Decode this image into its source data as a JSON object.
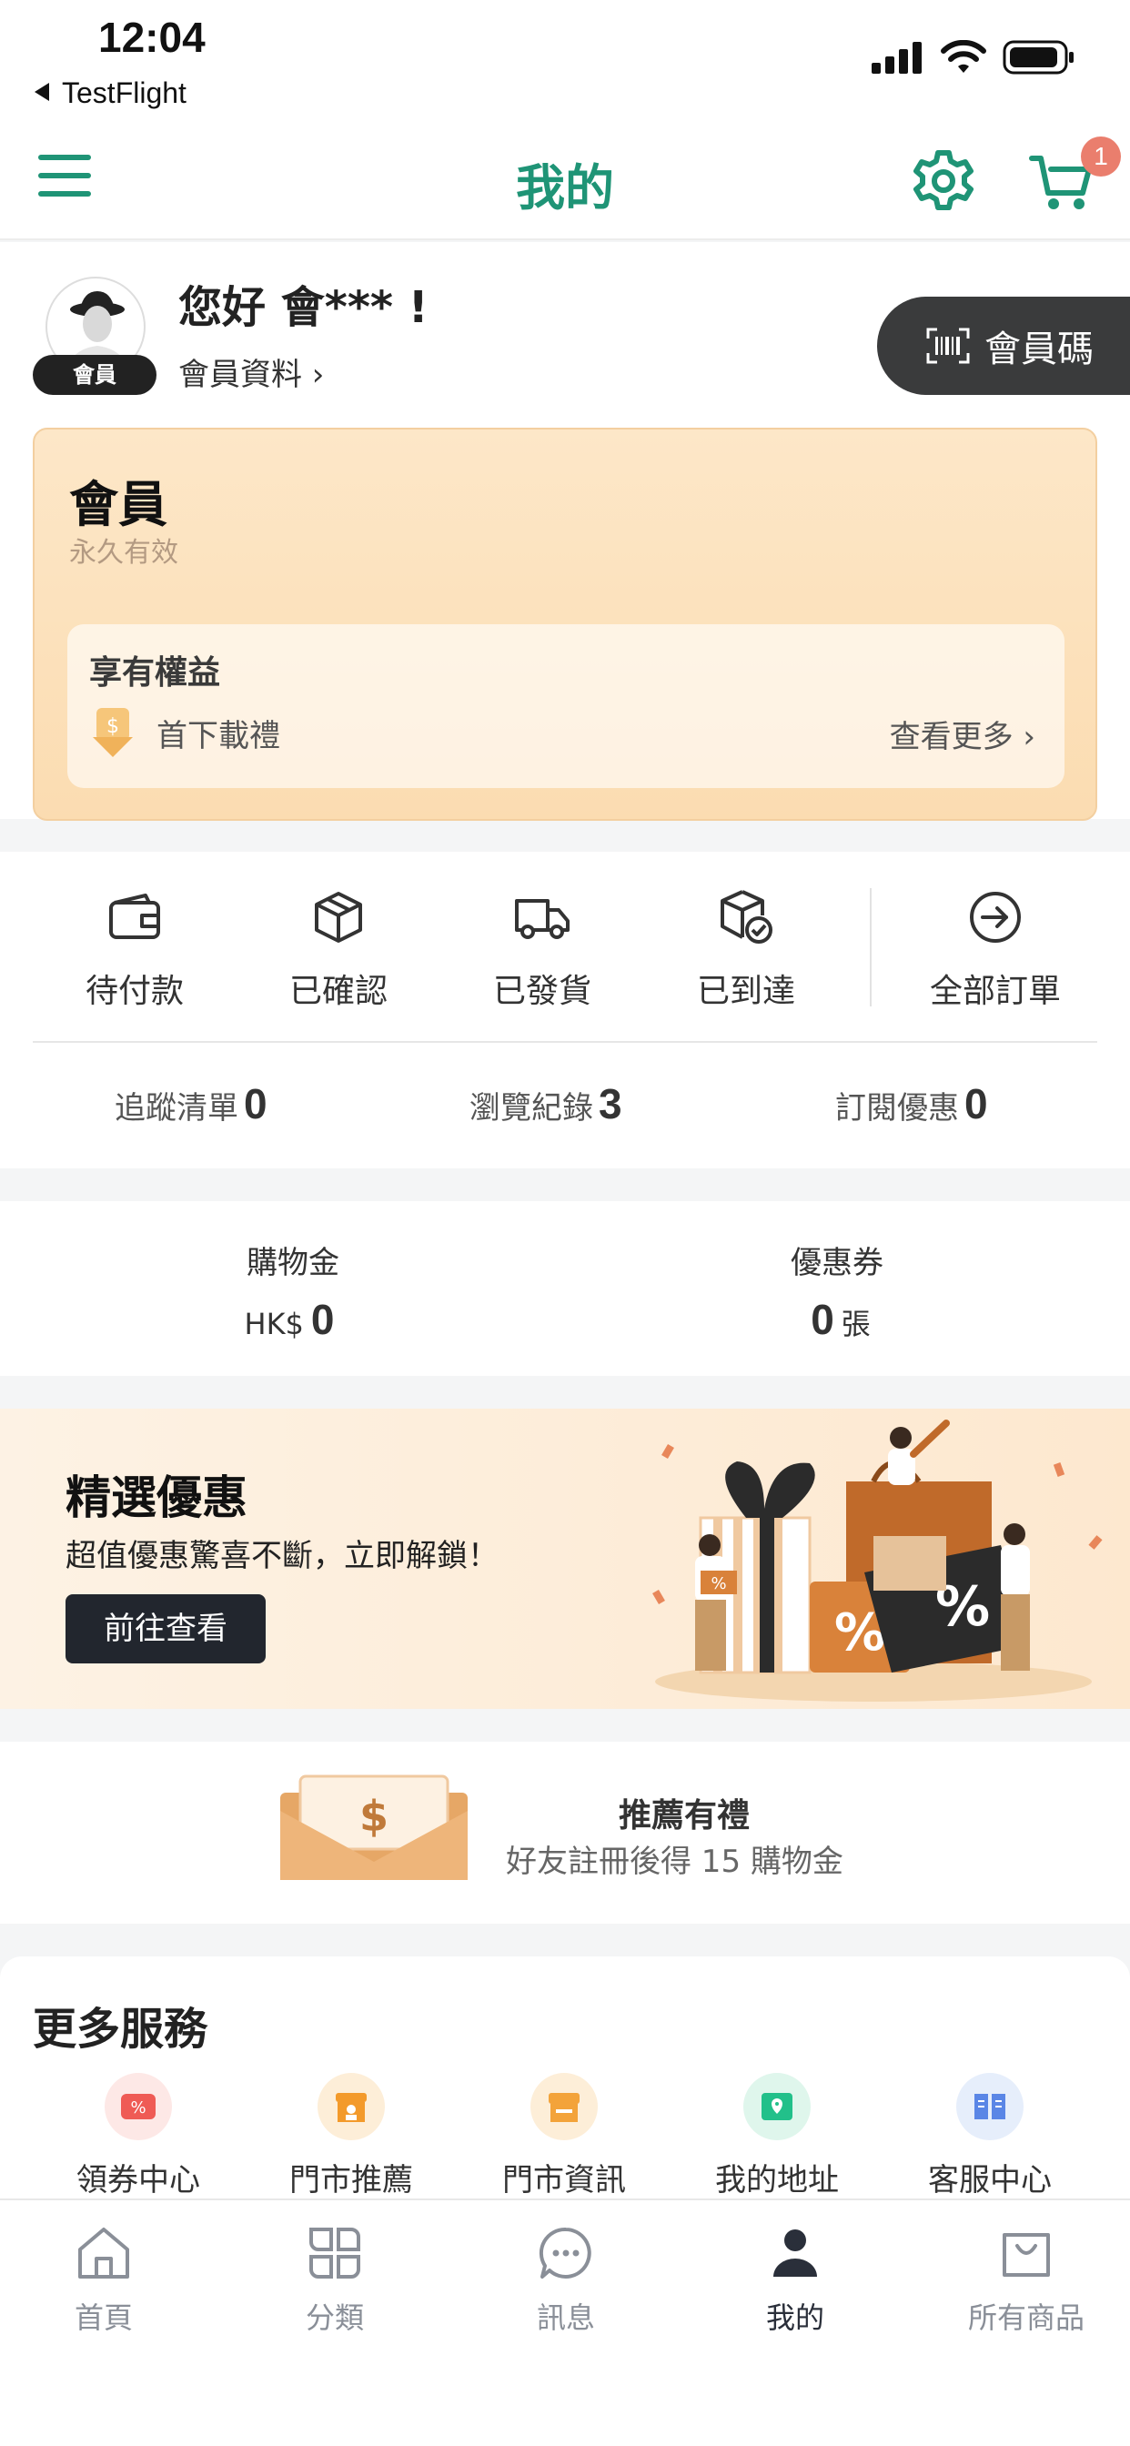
{
  "status_bar": {
    "time": "12:04",
    "back_app": "TestFlight"
  },
  "nav": {
    "title": "我的",
    "cart_count": "1"
  },
  "profile": {
    "greeting": "您好 會*** !",
    "badge": "會員",
    "profile_link": "會員資料 ›",
    "member_code_button": "會員碼"
  },
  "member_card": {
    "title": "會員",
    "validity": "永久有效",
    "benefits_title": "享有權益",
    "benefit_item": "首下載禮",
    "see_more": "查看更多 ›"
  },
  "orders": {
    "items": [
      {
        "label": "待付款",
        "icon": "wallet-icon"
      },
      {
        "label": "已確認",
        "icon": "box-icon"
      },
      {
        "label": "已發貨",
        "icon": "truck-icon"
      },
      {
        "label": "已到達",
        "icon": "box-check-icon"
      }
    ],
    "all_orders": "全部訂單"
  },
  "stats": {
    "watchlist_label": "追蹤清單",
    "watchlist_count": "0",
    "history_label": "瀏覽紀錄",
    "history_count": "3",
    "subscription_label": "訂閱優惠",
    "subscription_count": "0"
  },
  "wallet": {
    "credit_label": "購物金",
    "credit_currency": "HK$",
    "credit_value": "0",
    "coupon_label": "優惠券",
    "coupon_value": "0",
    "coupon_unit": "張"
  },
  "promo": {
    "title": "精選優惠",
    "subtitle": "超值優惠驚喜不斷，立即解鎖！",
    "button": "前往查看"
  },
  "referral": {
    "title": "推薦有禮",
    "subtitle": "好友註冊後得 15 購物金"
  },
  "services": {
    "title": "更多服務",
    "items": [
      {
        "label": "領券中心",
        "icon": "coupon-icon",
        "color": "#ef5b55"
      },
      {
        "label": "門市推薦",
        "icon": "store-recommend-icon",
        "color": "#f39a2b"
      },
      {
        "label": "門市資訊",
        "icon": "store-info-icon",
        "color": "#f3a33a"
      },
      {
        "label": "我的地址",
        "icon": "address-icon",
        "color": "#22c08a"
      },
      {
        "label": "客服中心",
        "icon": "help-book-icon",
        "color": "#5a86e6"
      }
    ]
  },
  "tabbar": {
    "items": [
      {
        "label": "首頁",
        "icon": "home-icon"
      },
      {
        "label": "分類",
        "icon": "category-icon"
      },
      {
        "label": "訊息",
        "icon": "message-icon"
      },
      {
        "label": "我的",
        "icon": "profile-icon"
      },
      {
        "label": "所有商品",
        "icon": "shopping-bag-icon"
      }
    ],
    "active": "我的"
  },
  "colors": {
    "brand": "#1f9476",
    "badge": "#ea7e6d",
    "dark_button": "#22262e"
  }
}
